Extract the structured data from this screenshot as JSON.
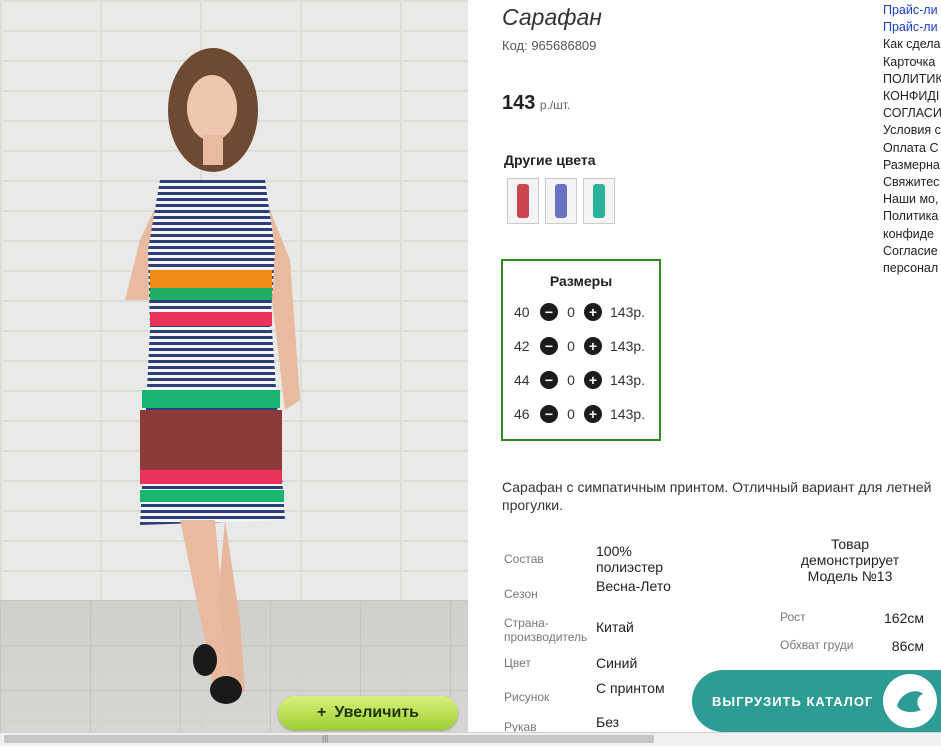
{
  "product": {
    "title": "Сарафан",
    "code": "Код: 965686809",
    "price": "143",
    "price_unit": "р./шт."
  },
  "zoom_button": {
    "icon": "+",
    "label": "Увеличить"
  },
  "other_colors": {
    "title": "Другие цвета",
    "swatches": [
      {
        "color": "#c9454f"
      },
      {
        "color": "#6b72c4"
      },
      {
        "color": "#2bb39a"
      }
    ]
  },
  "sizes": {
    "title": "Размеры",
    "rows": [
      {
        "size": "40",
        "qty": "0",
        "price": "143р."
      },
      {
        "size": "42",
        "qty": "0",
        "price": "143р."
      },
      {
        "size": "44",
        "qty": "0",
        "price": "143р."
      },
      {
        "size": "46",
        "qty": "0",
        "price": "143р."
      }
    ],
    "minus": "−",
    "plus": "+"
  },
  "description": "Сарафан с симпатичным принтом. Отличный вариант для летней прогулки.",
  "properties": [
    {
      "key": "Состав",
      "value": "100% полиэстер"
    },
    {
      "key": "Сезон",
      "value": "Весна-Лето"
    },
    {
      "key": "Страна-производитель",
      "value": "Китай"
    },
    {
      "key": "Цвет",
      "value": "Синий"
    },
    {
      "key": "Рисунок",
      "value": "С принтом"
    },
    {
      "key": "Рукав",
      "value": "Без"
    }
  ],
  "model": {
    "heading": "Товар демонстрирует Модель №13",
    "rows": [
      {
        "key": "Рост",
        "value": "162см"
      },
      {
        "key": "Обхват груди",
        "value": "86см"
      }
    ]
  },
  "side_links": [
    "Прайс-ли",
    "Прайс-ли",
    "Как сдела",
    "Карточка",
    "ПОЛИТИК",
    "КОНФИДІ",
    "СОГЛАСИ",
    "Условия с",
    "Оплата С",
    "Размерна",
    "Свяжитес",
    "Наши мо,",
    "Политика",
    "конфиде",
    "Согласие",
    "персонал"
  ],
  "catalog_button": {
    "label": "ВЫГРУЗИТЬ КАТАЛОГ"
  },
  "colors": {
    "accent_green": "#2e8b1f",
    "link_blue": "#1b3fd0",
    "catalog_teal": "#2d9c95"
  }
}
